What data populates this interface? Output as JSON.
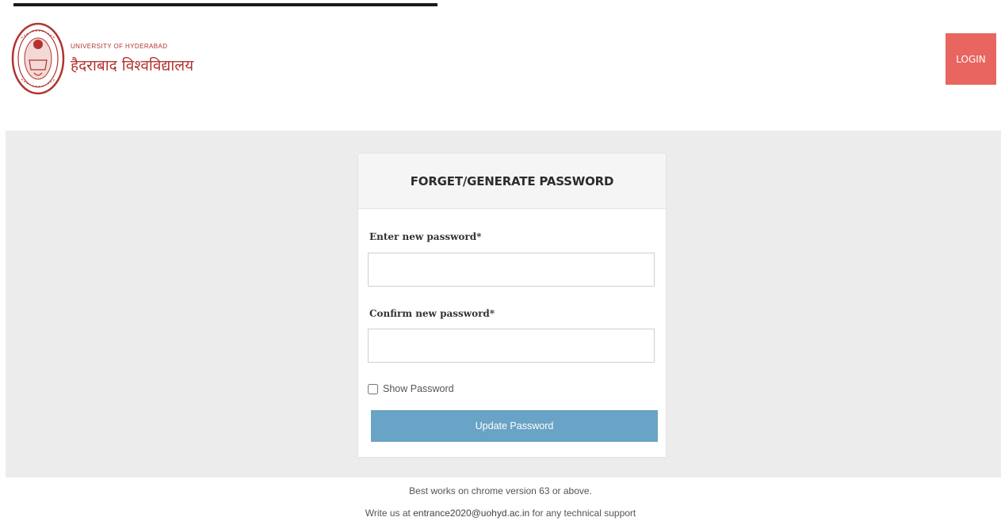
{
  "header": {
    "university_en": "UNIVERSITY OF HYDERABAD",
    "university_hi": "हैदराबाद विश्वविद्यालय",
    "login_label": "LOGIN"
  },
  "form": {
    "title": "FORGET/GENERATE PASSWORD",
    "new_password_label": "Enter new password*",
    "new_password_value": "",
    "confirm_password_label": "Confirm new password*",
    "confirm_password_value": "",
    "show_password_label": "Show Password",
    "show_password_checked": false,
    "submit_label": "Update Password"
  },
  "footer": {
    "browser_note": "Best works on chrome version 63 or above.",
    "support_prefix": "Write us at",
    "support_email": "entrance2020@uohyd.ac.in",
    "support_suffix": "for any technical support"
  },
  "colors": {
    "brand_red": "#b2332f",
    "login_bg": "#e96560",
    "update_btn_bg": "#69a3c5",
    "page_band_bg": "#ececec"
  },
  "icons": {
    "logo": "university-seal-icon",
    "checkbox": "checkbox-icon"
  }
}
